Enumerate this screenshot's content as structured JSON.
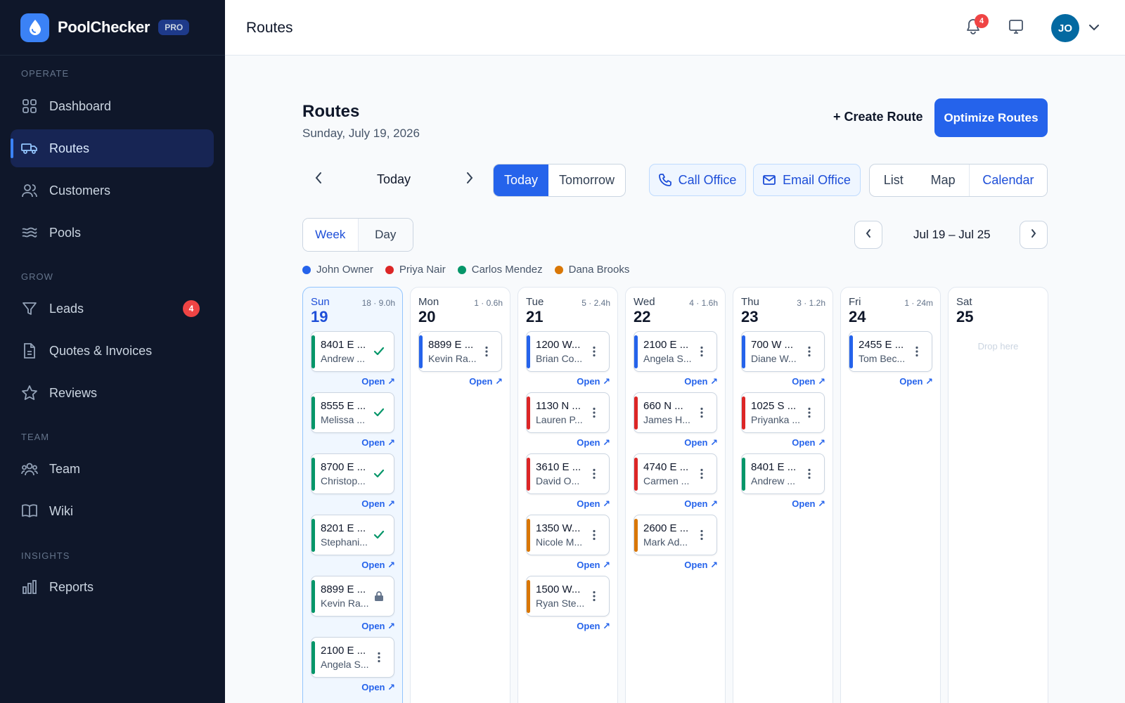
{
  "brand": {
    "name": "PoolChecker",
    "badge": "PRO"
  },
  "sidebar": {
    "sections": [
      {
        "label": "OPERATE"
      },
      {
        "label": "GROW"
      },
      {
        "label": "TEAM"
      },
      {
        "label": "INSIGHTS"
      }
    ],
    "items": [
      {
        "label": "Dashboard",
        "icon": "dashboard-grid-icon"
      },
      {
        "label": "Routes",
        "icon": "truck-icon",
        "active": true
      },
      {
        "label": "Customers",
        "icon": "users-icon"
      },
      {
        "label": "Pools",
        "icon": "waves-icon"
      },
      {
        "label": "Leads",
        "icon": "funnel-icon",
        "badge": "4"
      },
      {
        "label": "Quotes & Invoices",
        "icon": "document-icon"
      },
      {
        "label": "Reviews",
        "icon": "star-icon"
      },
      {
        "label": "Team",
        "icon": "team-icon"
      },
      {
        "label": "Wiki",
        "icon": "book-icon"
      },
      {
        "label": "Reports",
        "icon": "bar-chart-icon"
      }
    ]
  },
  "topbar": {
    "title": "Routes",
    "notifications": "4",
    "avatar_initials": "JO"
  },
  "header": {
    "title": "Routes",
    "date": "Sunday, July 19, 2026",
    "create_label": "+ Create Route",
    "optimize_label": "Optimize Routes"
  },
  "toolbar": {
    "day_label": "Today",
    "quick_days": [
      "Today",
      "Tomorrow"
    ],
    "call_label": "Call Office",
    "email_label": "Email Office",
    "views": [
      "List",
      "Map",
      "Calendar"
    ],
    "view_selected": "Calendar"
  },
  "calendar": {
    "modes": [
      "Week",
      "Day"
    ],
    "range_label": "Jul 19 – Jul 25",
    "drop_label": "Drop here",
    "open_label": "Open ↗",
    "legend": [
      {
        "name": "John Owner",
        "color": "#2563eb"
      },
      {
        "name": "Priya Nair",
        "color": "#dc2626"
      },
      {
        "name": "Carlos Mendez",
        "color": "#059669"
      },
      {
        "name": "Dana Brooks",
        "color": "#d97706"
      }
    ],
    "days": [
      {
        "name": "Sun",
        "num": "19",
        "meta": "18 · 9.0h",
        "current": true,
        "stops": [
          {
            "addr": "8401 E ...",
            "name": "Andrew ...",
            "color": "#059669",
            "status": "done"
          },
          {
            "addr": "8555 E ...",
            "name": "Melissa ...",
            "color": "#059669",
            "status": "done"
          },
          {
            "addr": "8700 E ...",
            "name": "Christop...",
            "color": "#059669",
            "status": "done"
          },
          {
            "addr": "8201 E ...",
            "name": "Stephani...",
            "color": "#059669",
            "status": "done"
          },
          {
            "addr": "8899 E ...",
            "name": "Kevin Ra...",
            "color": "#059669",
            "status": "locked"
          },
          {
            "addr": "2100 E ...",
            "name": "Angela S...",
            "color": "#059669",
            "status": "menu"
          }
        ]
      },
      {
        "name": "Mon",
        "num": "20",
        "meta": "1 · 0.6h",
        "stops": [
          {
            "addr": "8899 E ...",
            "name": "Kevin Ra...",
            "color": "#2563eb",
            "status": "menu"
          }
        ]
      },
      {
        "name": "Tue",
        "num": "21",
        "meta": "5 · 2.4h",
        "stops": [
          {
            "addr": "1200 W...",
            "name": "Brian Co...",
            "color": "#2563eb",
            "status": "menu"
          },
          {
            "addr": "1130 N ...",
            "name": "Lauren P...",
            "color": "#dc2626",
            "status": "menu"
          },
          {
            "addr": "3610 E ...",
            "name": "David O...",
            "color": "#dc2626",
            "status": "menu"
          },
          {
            "addr": "1350 W...",
            "name": "Nicole M...",
            "color": "#d97706",
            "status": "menu"
          },
          {
            "addr": "1500 W...",
            "name": "Ryan Ste...",
            "color": "#d97706",
            "status": "menu"
          }
        ]
      },
      {
        "name": "Wed",
        "num": "22",
        "meta": "4 · 1.6h",
        "stops": [
          {
            "addr": "2100 E ...",
            "name": "Angela S...",
            "color": "#2563eb",
            "status": "menu"
          },
          {
            "addr": "660 N ...",
            "name": "James H...",
            "color": "#dc2626",
            "status": "menu"
          },
          {
            "addr": "4740 E ...",
            "name": "Carmen ...",
            "color": "#dc2626",
            "status": "menu"
          },
          {
            "addr": "2600 E ...",
            "name": "Mark Ad...",
            "color": "#d97706",
            "status": "menu"
          }
        ]
      },
      {
        "name": "Thu",
        "num": "23",
        "meta": "3 · 1.2h",
        "stops": [
          {
            "addr": "700 W ...",
            "name": "Diane W...",
            "color": "#2563eb",
            "status": "menu"
          },
          {
            "addr": "1025 S ...",
            "name": "Priyanka ...",
            "color": "#dc2626",
            "status": "menu"
          },
          {
            "addr": "8401 E ...",
            "name": "Andrew ...",
            "color": "#059669",
            "status": "menu"
          }
        ]
      },
      {
        "name": "Fri",
        "num": "24",
        "meta": "1 · 24m",
        "stops": [
          {
            "addr": "2455 E ...",
            "name": "Tom Bec...",
            "color": "#2563eb",
            "status": "menu"
          }
        ]
      },
      {
        "name": "Sat",
        "num": "25",
        "meta": "",
        "stops": []
      }
    ]
  }
}
